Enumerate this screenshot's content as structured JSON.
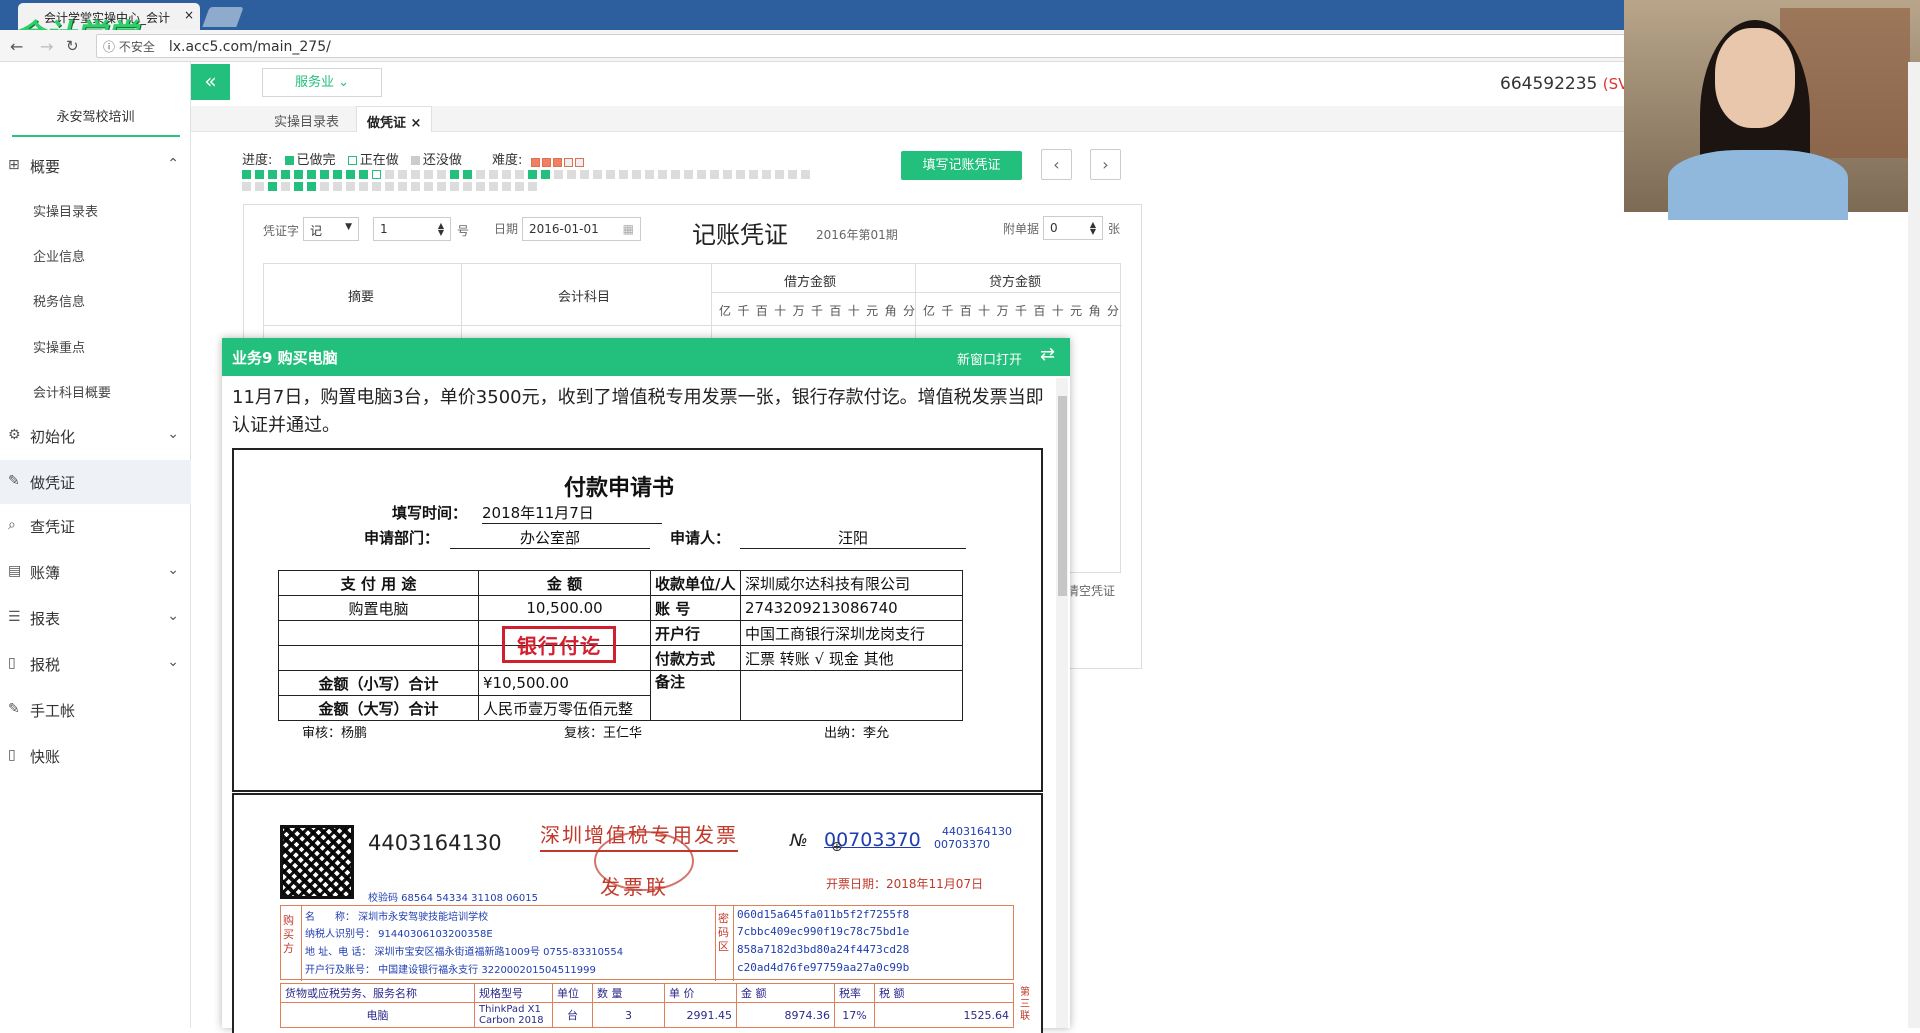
{
  "browser": {
    "tab_title": "会计学堂实操中心_会计",
    "tab_close": "×",
    "logo_text": "会计学堂",
    "insecure_label": "不安全",
    "url": "lx.acc5.com/main_275/"
  },
  "sidebar": {
    "org_name": "永安驾校培训",
    "items": [
      {
        "label": "概要",
        "icon": "grid-icon",
        "expanded": true
      },
      {
        "label": "初始化",
        "icon": "gear-icon"
      },
      {
        "label": "做凭证",
        "icon": "pen-icon"
      },
      {
        "label": "查凭证",
        "icon": "search-icon"
      },
      {
        "label": "账簿",
        "icon": "book-icon"
      },
      {
        "label": "报表",
        "icon": "list-icon"
      },
      {
        "label": "报税",
        "icon": "file-icon"
      },
      {
        "label": "手工帐",
        "icon": "pen-icon"
      },
      {
        "label": "快账",
        "icon": "file-icon"
      }
    ],
    "sub_items": [
      "实操目录表",
      "企业信息",
      "税务信息",
      "实操重点",
      "会计科目概要"
    ]
  },
  "topbar": {
    "collapse_icon": "«",
    "industry_select": "服务业",
    "account_id": "664592235",
    "account_suffix": "(SVI"
  },
  "tabs": [
    {
      "label": "实操目录表",
      "active": false
    },
    {
      "label": "做凭证",
      "active": true,
      "close": "×"
    }
  ],
  "progress": {
    "label": "进度:",
    "legend_done": "已做完",
    "legend_doing": "正在做",
    "legend_todo": "还没做",
    "difficulty_label": "难度:",
    "difficulty_stars": 3,
    "difficulty_max": 5
  },
  "actions": {
    "fill_voucher": "填写记账凭证",
    "prev": "‹",
    "next": "›"
  },
  "voucher": {
    "word_label": "凭证字",
    "word_value": "记",
    "number_value": "1",
    "number_suffix": "号",
    "date_label": "日期",
    "date_value": "2016-01-01",
    "title": "记账凭证",
    "period": "2016年第01期",
    "attach_label": "附单据",
    "attach_value": "0",
    "attach_suffix": "张",
    "col_summary": "摘要",
    "col_account": "会计科目",
    "col_debit": "借方金额",
    "col_credit": "贷方金额",
    "digits": [
      "亿",
      "千",
      "百",
      "十",
      "万",
      "千",
      "百",
      "十",
      "元",
      "角",
      "分"
    ],
    "clear_label": "清空凭证"
  },
  "popup": {
    "title": "业务9 购买电脑",
    "open_new": "新窗口打开",
    "description": "11月7日，购置电脑3台，单价3500元，收到了增值税专用发票一张，银行存款付讫。增值税发票当即认证并通过。"
  },
  "payment_request": {
    "title": "付款申请书",
    "fill_time_label": "填写时间：",
    "fill_time": "2018年11月7日",
    "dept_label": "申请部门：",
    "dept": "办公室部",
    "applicant_label": "申请人：",
    "applicant": "汪阳",
    "h_purpose": "支 付 用 途",
    "h_amount": "金 额",
    "h_payee": "收款单位/人",
    "purpose": "购置电脑",
    "amount": "10,500.00",
    "payee": "深圳威尔达科技有限公司",
    "acct_label": "账 号",
    "acct": "2743209213086740",
    "bank_label": "开户行",
    "bank": "中国工商银行深圳龙岗支行",
    "stamp": "银行付讫",
    "method_label": "付款方式",
    "method": "汇票  转账 √  现金    其他",
    "note_label": "备注",
    "small_total_label": "金额（小写）合计",
    "small_total": "¥10,500.00",
    "big_total_label": "金额（大写）合计",
    "big_total": "人民币壹万零伍佰元整",
    "reviewer": "审核：杨鹏",
    "checker": "复核：王仁华",
    "cashier": "出纳：李允"
  },
  "invoice": {
    "code": "4403164130",
    "title": "深圳增值税专用发票",
    "subtitle": "发票联",
    "no_label": "№",
    "number": "00703370",
    "code_small": "4403164130",
    "number_small": "00703370",
    "issue_date": "开票日期：2018年11月07日",
    "check_code": "校验码 68564 54334 31108 06015",
    "buyer_vlabel": "购买方",
    "buyer_name": "名　　称： 深圳市永安驾驶技能培训学校",
    "buyer_tax": "纳税人识别号： 91440306103200358E",
    "buyer_addr": "地 址、电 话： 深圳市宝安区福永街道福新路1009号 0755-83310554",
    "buyer_bank": "开户行及账号： 中国建设银行福永支行 322000201504511999",
    "cipher_label": "密码区",
    "cipher": [
      "060d15a645fa011b5f2f7255f8",
      "7cbbc409ec990f19c78c75bd1e",
      "858a7182d3bd80a24f4473cd28",
      "c20ad4d76fe97759aa27a0c99b"
    ],
    "item_headers": [
      "货物或应税劳务、服务名称",
      "规格型号",
      "单位",
      "数 量",
      "单 价",
      "金 额",
      "税率",
      "税 额"
    ],
    "item": [
      "电脑",
      "ThinkPad X1 Carbon 2018",
      "台",
      "3",
      "2991.45",
      "8974.36",
      "17%",
      "1525.64"
    ],
    "side_label": "第三联"
  }
}
